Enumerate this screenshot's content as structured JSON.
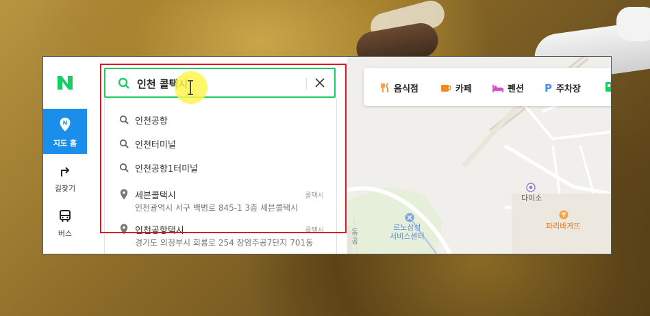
{
  "search": {
    "query": "인천 콜택시"
  },
  "rail": {
    "items": [
      {
        "label": "지도 홈",
        "active": true
      },
      {
        "label": "길찾기"
      },
      {
        "label": "버스"
      }
    ]
  },
  "suggestions": [
    {
      "text": "인천공항"
    },
    {
      "text": "인천터미널"
    },
    {
      "text": "인천공항1터미널"
    }
  ],
  "places": [
    {
      "name": "세븐콜택시",
      "category": "콜택시",
      "address": "인천광역시 서구 백범로 845-1 3층 세븐콜택시"
    },
    {
      "name": "인천공항택시",
      "category": "콜택시",
      "address": "경기도 의정부시 회룡로 254 장암주공7단지 701동"
    }
  ],
  "categories": [
    {
      "label": "음식점",
      "icon": "restaurant-icon",
      "color": "#f08a24"
    },
    {
      "label": "카페",
      "icon": "cafe-icon",
      "color": "#f08a24"
    },
    {
      "label": "펜션",
      "icon": "bed-icon",
      "color": "#d64ac9"
    },
    {
      "label": "주차장",
      "icon": "parking-icon",
      "color": "#4a8bf0"
    }
  ],
  "map_labels": {
    "store": "다이소",
    "bakery": "파리바게뜨",
    "service": "르노삼성\n서비스센터",
    "partial": "동\n공"
  },
  "colors": {
    "brand": "#19ce60",
    "accent": "#1a8eea",
    "highlight": "#e0141e"
  }
}
